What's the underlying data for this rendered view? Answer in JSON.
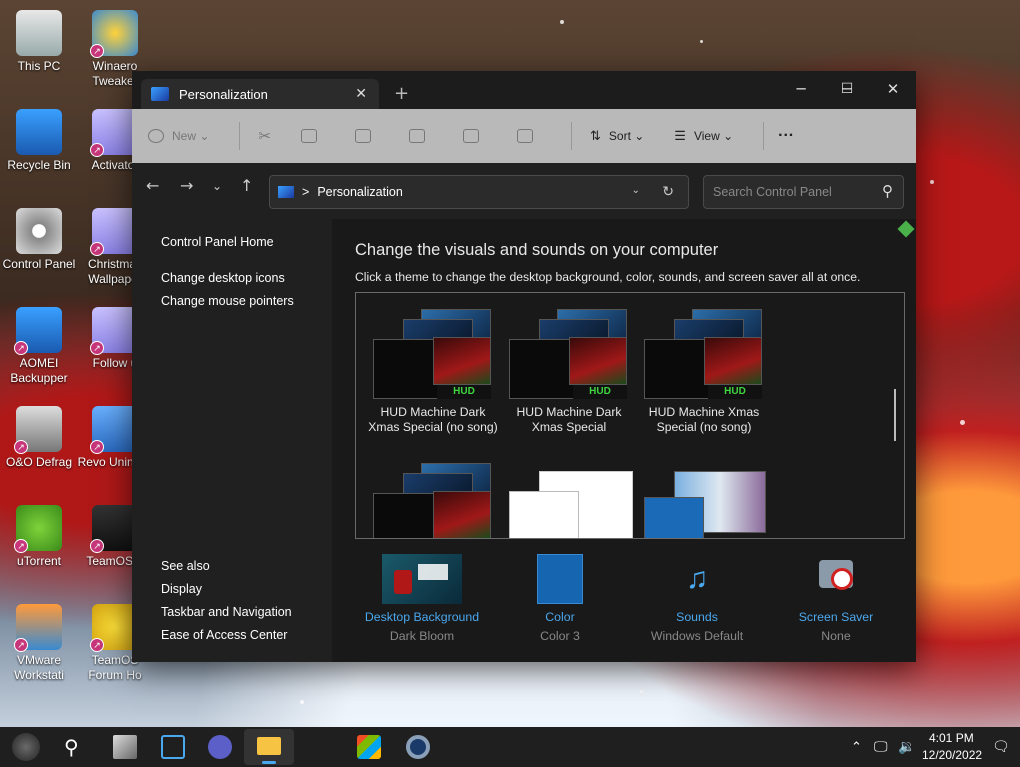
{
  "desktop": {
    "icons": [
      {
        "label": "This PC",
        "icon": "this-pc-icon"
      },
      {
        "label": "Winaero Tweaker",
        "icon": "winaero-icon"
      },
      {
        "label": "Recycle Bin",
        "icon": "recycle-bin-icon"
      },
      {
        "label": "Activator",
        "icon": "folder-icon"
      },
      {
        "label": "Control Panel",
        "icon": "control-panel-icon"
      },
      {
        "label": "Christmas Wallpaper",
        "icon": "folder-icon"
      },
      {
        "label": "AOMEI Backupper",
        "icon": "aomei-icon"
      },
      {
        "label": "Follow u",
        "icon": "folder-icon"
      },
      {
        "label": "O&O Defrag",
        "icon": "defrag-icon"
      },
      {
        "label": "Revo Uninstal",
        "icon": "revo-icon"
      },
      {
        "label": "uTorrent",
        "icon": "utorrent-icon"
      },
      {
        "label": "TeamOS F",
        "icon": "teamos-icon"
      },
      {
        "label": "VMware Workstati",
        "icon": "vmware-icon"
      },
      {
        "label": "TeamOS Forum Ho",
        "icon": "star-icon"
      }
    ]
  },
  "window": {
    "tab_title": "Personalization",
    "toolbar": {
      "new": "New",
      "sort": "Sort",
      "view": "View",
      "more": "···"
    },
    "address": {
      "path": "Personalization",
      "separator": ">"
    },
    "search": {
      "placeholder": "Search Control Panel"
    },
    "sidebar": {
      "home": "Control Panel Home",
      "links": [
        "Change desktop icons",
        "Change mouse pointers"
      ],
      "see_also_header": "See also",
      "see_also": [
        "Display",
        "Taskbar and Navigation",
        "Ease of Access Center"
      ]
    },
    "content": {
      "heading": "Change the visuals and sounds on your computer",
      "subheading": "Click a theme to change the desktop background, color, sounds, and screen saver all at once.",
      "themes": [
        {
          "name": "HUD Machine Dark Xmas Special (no song)"
        },
        {
          "name": "HUD Machine Dark Xmas Special"
        },
        {
          "name": "HUD Machine Xmas Special (no song)"
        }
      ],
      "bottom": [
        {
          "label": "Desktop Background",
          "value": "Dark Bloom"
        },
        {
          "label": "Color",
          "value": "Color 3"
        },
        {
          "label": "Sounds",
          "value": "Windows Default"
        },
        {
          "label": "Screen Saver",
          "value": "None"
        }
      ],
      "hud_logo": "HUD"
    }
  },
  "taskbar": {
    "time": "4:01 PM",
    "date": "12/20/2022"
  }
}
